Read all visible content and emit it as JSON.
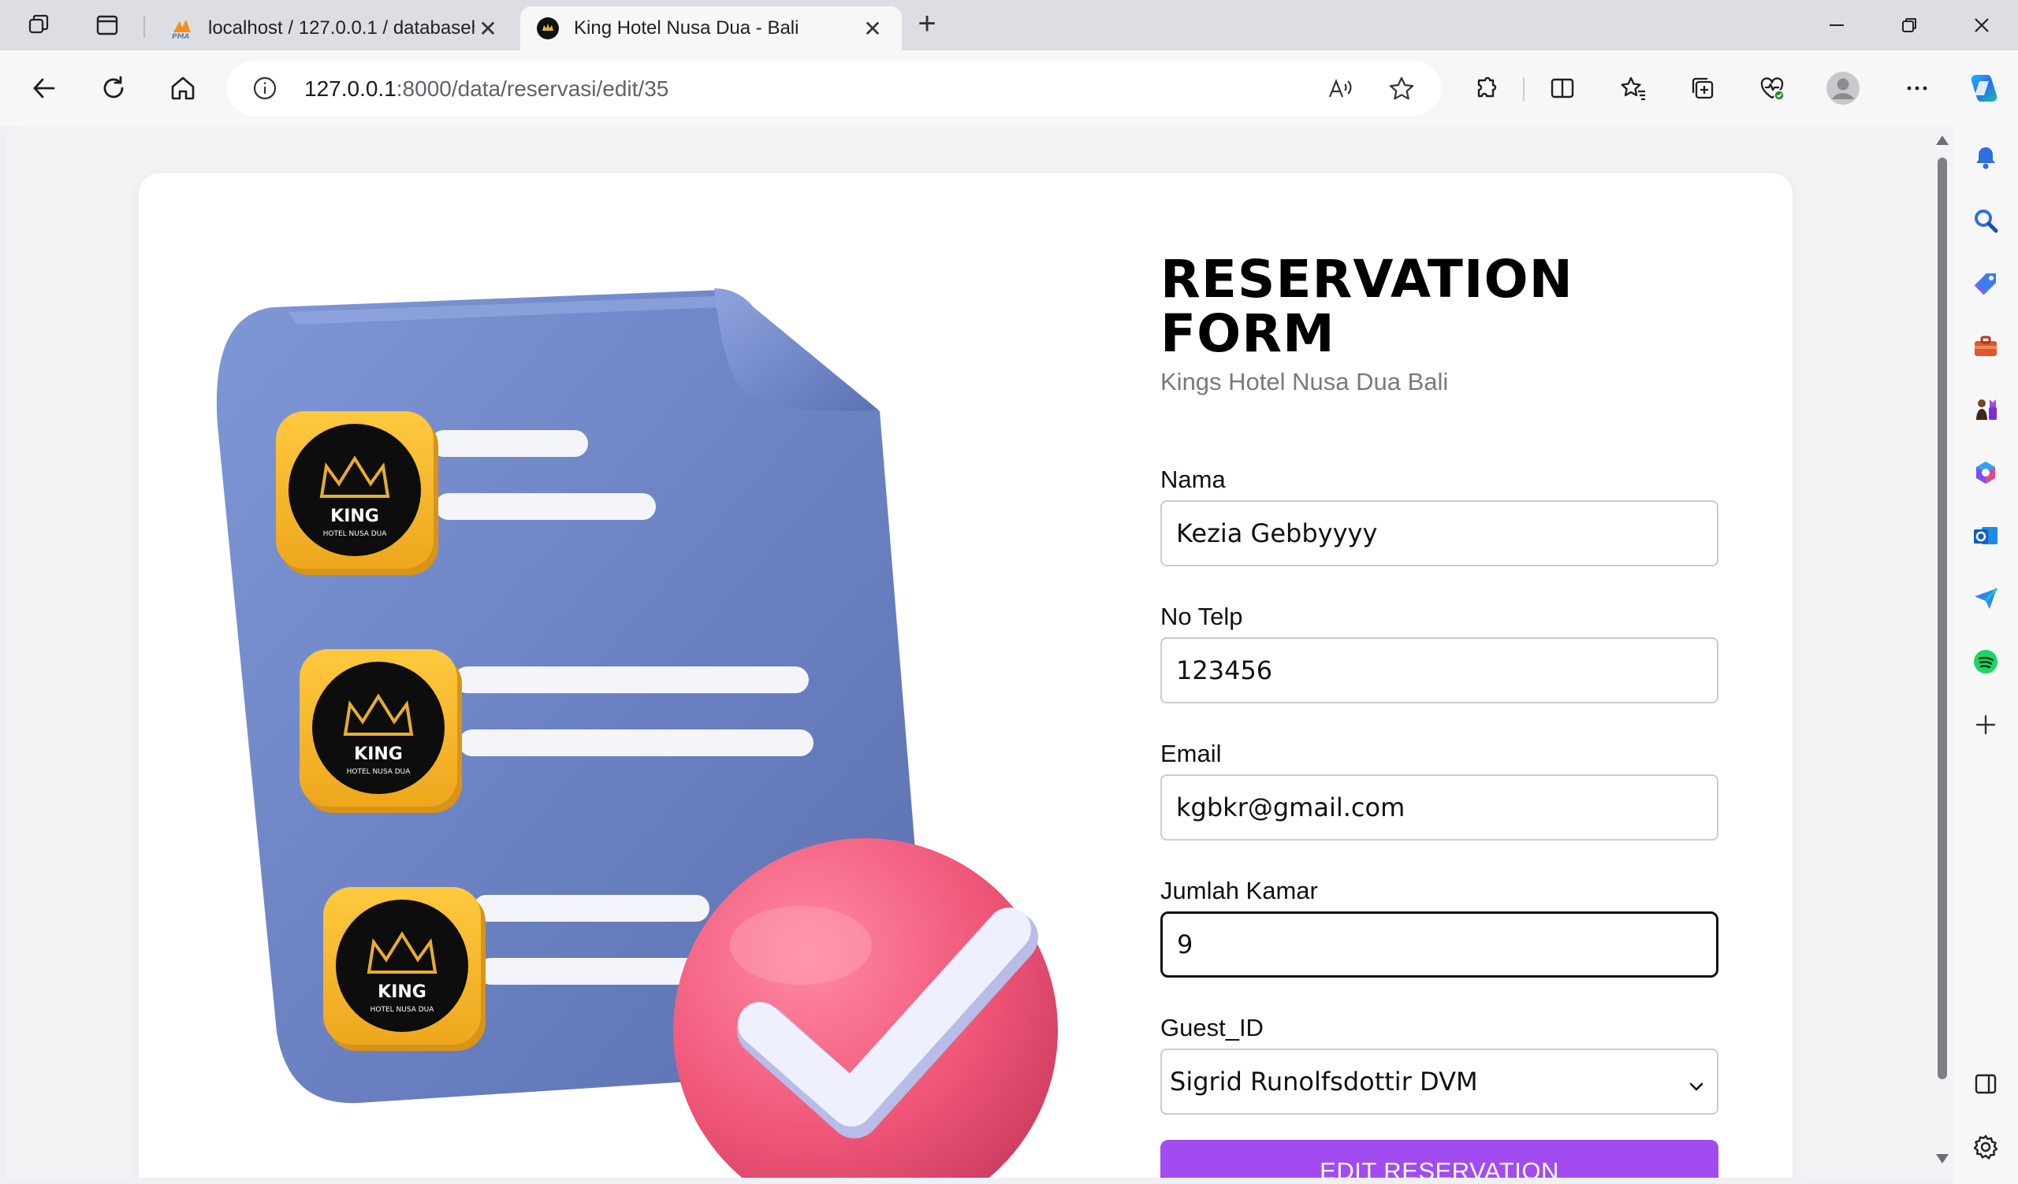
{
  "tabs": [
    {
      "title": "localhost / 127.0.0.1 / databaseh",
      "favicon": "phpmyadmin-icon",
      "favicon_text": "PMA",
      "active": false
    },
    {
      "title": "King Hotel Nusa Dua - Bali",
      "favicon": "king-hotel-icon",
      "active": true
    }
  ],
  "address_bar": {
    "host": "127.0.0.1",
    "path": ":8000/data/reservasi/edit/35"
  },
  "form": {
    "title": "RESERVATION FORM",
    "subtitle": "Kings Hotel Nusa Dua Bali",
    "fields": [
      {
        "label": "Nama",
        "value": "Kezia Gebbyyyy"
      },
      {
        "label": "No Telp",
        "value": "123456"
      },
      {
        "label": "Email",
        "value": "kgbkr@gmail.com"
      },
      {
        "label": "Jumlah Kamar",
        "value": "9"
      }
    ],
    "guest": {
      "label": "Guest_ID",
      "selected": "Sigrid Runolfsdottir DVM"
    },
    "submit_label": "EDIT RESERVATION"
  },
  "illustration": {
    "logo_word": "KING",
    "logo_sub": "HOTEL NUSA DUA"
  },
  "colors": {
    "accent": "#a14bf0",
    "doc_blue": "#6f86c8",
    "badge_yellow": "#f6b927",
    "check_pink": "#ef5c7e"
  }
}
